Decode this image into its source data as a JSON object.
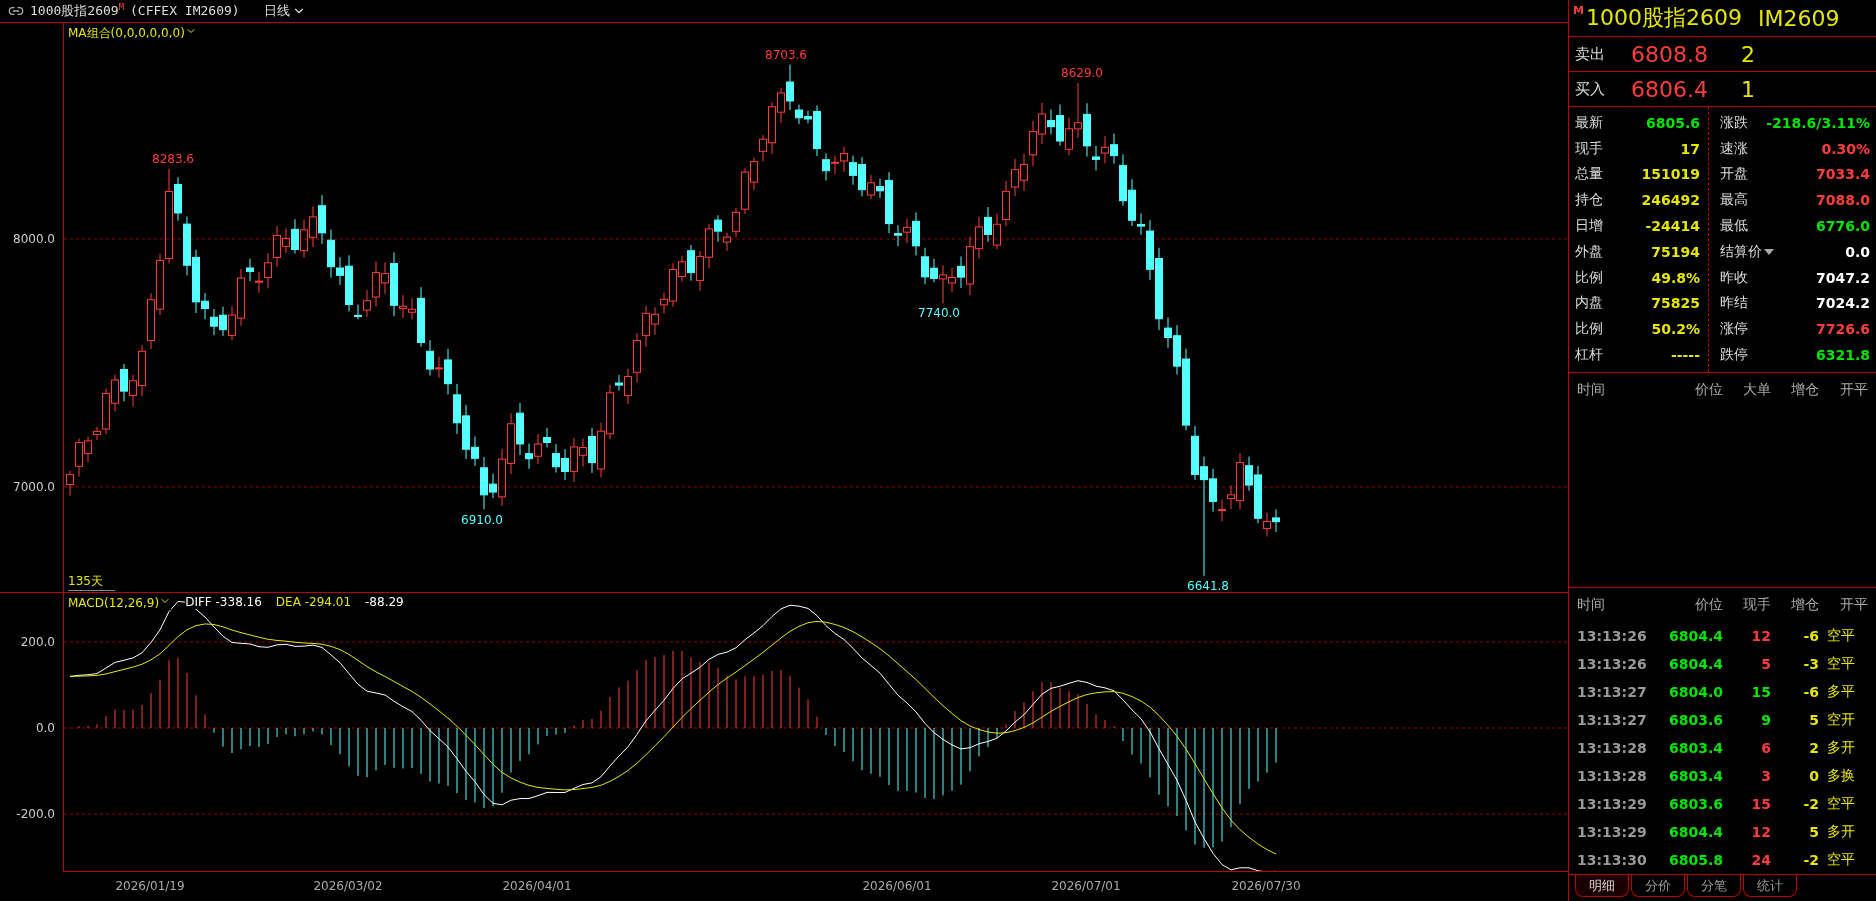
{
  "title_bar": {
    "name": "1000股指2609",
    "market_mark": "M",
    "code": "(CFFEX IM2609)",
    "period": "日线"
  },
  "main_chart": {
    "indicator": "MA组合(0,0,0,0,0,0)",
    "y_labels": [
      "8000.0",
      "7000.0"
    ],
    "span_label": "135天",
    "price_marks": [
      {
        "text": "8283.6",
        "kind": "high"
      },
      {
        "text": "6910.0",
        "kind": "low"
      },
      {
        "text": "8703.6",
        "kind": "high"
      },
      {
        "text": "7740.0",
        "kind": "low"
      },
      {
        "text": "8629.0",
        "kind": "high"
      },
      {
        "text": "6641.8",
        "kind": "low"
      }
    ]
  },
  "macd": {
    "name": "MACD(12,26,9)",
    "diff": "DIFF -338.16",
    "dea": "DEA -294.01",
    "value": "-88.29",
    "y_labels": [
      "200.0",
      "0.0",
      "-200.0"
    ]
  },
  "dates": [
    "2026/01/19",
    "2026/03/02",
    "2026/04/01",
    "2026/06/01",
    "2026/07/01",
    "2026/07/30"
  ],
  "quote": {
    "badge": "M",
    "name": "1000股指2609",
    "code": "IM2609",
    "ask": {
      "label": "卖出",
      "price": "6808.8",
      "volume": "2"
    },
    "bid": {
      "label": "买入",
      "price": "6806.4",
      "volume": "1"
    },
    "stats": [
      {
        "label": "最新",
        "value": "6805.6",
        "color": "#00e600",
        "has_menu": false
      },
      {
        "label": "涨跌",
        "value": "-218.6/3.11%",
        "color": "#00e600",
        "has_menu": false
      },
      {
        "label": "现手",
        "value": "17",
        "color": "#e6e600",
        "has_menu": false
      },
      {
        "label": "速涨",
        "value": "0.30%",
        "color": "#ff3c3c",
        "has_menu": false
      },
      {
        "label": "总量",
        "value": "151019",
        "color": "#e6e600",
        "has_menu": false
      },
      {
        "label": "开盘",
        "value": "7033.4",
        "color": "#ff3c3c",
        "has_menu": false
      },
      {
        "label": "持仓",
        "value": "246492",
        "color": "#e6e600",
        "has_menu": false
      },
      {
        "label": "最高",
        "value": "7088.0",
        "color": "#ff3c3c",
        "has_menu": false
      },
      {
        "label": "日增",
        "value": "-24414",
        "color": "#e6e600",
        "has_menu": false
      },
      {
        "label": "最低",
        "value": "6776.0",
        "color": "#00e600",
        "has_menu": false
      },
      {
        "label": "外盘",
        "value": "75194",
        "color": "#e6e600",
        "has_menu": false
      },
      {
        "label": "结算价",
        "value": "0.0",
        "color": "#ffffff",
        "has_menu": true
      },
      {
        "label": "比例",
        "value": "49.8%",
        "color": "#e6e600",
        "has_menu": false
      },
      {
        "label": "昨收",
        "value": "7047.2",
        "color": "#ffffff",
        "has_menu": false
      },
      {
        "label": "内盘",
        "value": "75825",
        "color": "#e6e600",
        "has_menu": false
      },
      {
        "label": "昨结",
        "value": "7024.2",
        "color": "#ffffff",
        "has_menu": false
      },
      {
        "label": "比例",
        "value": "50.2%",
        "color": "#e6e600",
        "has_menu": false
      },
      {
        "label": "涨停",
        "value": "7726.6",
        "color": "#ff3c3c",
        "has_menu": false
      },
      {
        "label": "杠杆",
        "value": "-----",
        "color": "#e6e600",
        "has_menu": false
      },
      {
        "label": "跌停",
        "value": "6321.8",
        "color": "#00e600",
        "has_menu": false
      }
    ],
    "big_orders": {
      "columns": [
        "时间",
        "价位",
        "大单",
        "增仓",
        "开平"
      ]
    },
    "ticks": {
      "columns": [
        "时间",
        "价位",
        "现手",
        "增仓",
        "开平"
      ],
      "rows": [
        {
          "time": "13:13:26",
          "price": "6804.4",
          "volume": "12",
          "color": "#ff3c3c",
          "change": "-6",
          "action": "空平"
        },
        {
          "time": "13:13:26",
          "price": "6804.4",
          "volume": "5",
          "color": "#ff3c3c",
          "change": "-3",
          "action": "空平"
        },
        {
          "time": "13:13:27",
          "price": "6804.0",
          "volume": "15",
          "color": "#00e600",
          "change": "-6",
          "action": "多平"
        },
        {
          "time": "13:13:27",
          "price": "6803.6",
          "volume": "9",
          "color": "#00e600",
          "change": "5",
          "action": "空开"
        },
        {
          "time": "13:13:28",
          "price": "6803.4",
          "volume": "6",
          "color": "#ff3c3c",
          "change": "2",
          "action": "多开"
        },
        {
          "time": "13:13:28",
          "price": "6803.4",
          "volume": "3",
          "color": "#ff3c3c",
          "change": "0",
          "action": "多换"
        },
        {
          "time": "13:13:29",
          "price": "6803.6",
          "volume": "15",
          "color": "#ff3c3c",
          "change": "-2",
          "action": "空平"
        },
        {
          "time": "13:13:29",
          "price": "6804.4",
          "volume": "12",
          "color": "#ff3c3c",
          "change": "5",
          "action": "多开"
        },
        {
          "time": "13:13:30",
          "price": "6805.8",
          "volume": "24",
          "color": "#ff3c3c",
          "change": "-2",
          "action": "空平"
        }
      ]
    },
    "tabs": [
      {
        "label": "明细",
        "selected": true
      },
      {
        "label": "分价",
        "selected": false
      },
      {
        "label": "分笔",
        "selected": false
      },
      {
        "label": "统计",
        "selected": false
      }
    ]
  }
}
